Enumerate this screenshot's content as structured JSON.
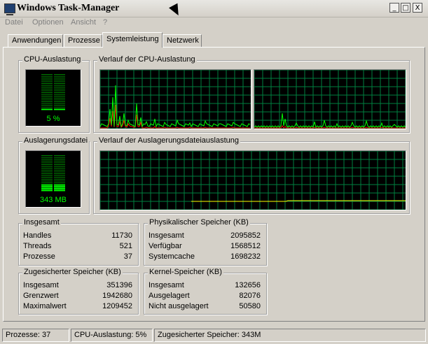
{
  "window": {
    "title": "Windows Task-Manager",
    "buttons": {
      "minimize": "_",
      "maximize": "□",
      "close": "X"
    }
  },
  "menu": {
    "items": [
      "Datei",
      "Optionen",
      "Ansicht",
      "?"
    ]
  },
  "tabs": [
    {
      "label": "Anwendungen",
      "active": false
    },
    {
      "label": "Prozesse",
      "active": false
    },
    {
      "label": "Systemleistung",
      "active": true
    },
    {
      "label": "Netzwerk",
      "active": false
    }
  ],
  "cpu_usage": {
    "title": "CPU-Auslastung",
    "value_text": "5 %",
    "percent": 5
  },
  "cpu_history": {
    "title": "Verlauf der CPU-Auslastung"
  },
  "pagefile": {
    "title": "Auslagerungsdatei",
    "value_text": "343 MB"
  },
  "pagefile_history": {
    "title": "Verlauf der Auslagerungsdateiauslastung"
  },
  "totals": {
    "title": "Insgesamt",
    "rows": [
      {
        "label": "Handles",
        "value": "11730"
      },
      {
        "label": "Threads",
        "value": "521"
      },
      {
        "label": "Prozesse",
        "value": "37"
      }
    ]
  },
  "physical_memory": {
    "title": "Physikalischer Speicher (KB)",
    "rows": [
      {
        "label": "Insgesamt",
        "value": "2095852"
      },
      {
        "label": "Verfügbar",
        "value": "1568512"
      },
      {
        "label": "Systemcache",
        "value": "1698232"
      }
    ]
  },
  "commit_charge": {
    "title": "Zugesicherter Speicher (KB)",
    "rows": [
      {
        "label": "Insgesamt",
        "value": "351396"
      },
      {
        "label": "Grenzwert",
        "value": "1942680"
      },
      {
        "label": "Maximalwert",
        "value": "1209452"
      }
    ]
  },
  "kernel_memory": {
    "title": "Kernel-Speicher (KB)",
    "rows": [
      {
        "label": "Insgesamt",
        "value": "132656"
      },
      {
        "label": "Ausgelagert",
        "value": "82076"
      },
      {
        "label": "Nicht ausgelagert",
        "value": "50580"
      }
    ]
  },
  "statusbar": {
    "processes": "Prozesse: 37",
    "cpu": "CPU-Auslastung: 5%",
    "commit": "Zugesicherter Speicher: 343M"
  },
  "colors": {
    "grid": "#008040",
    "line_green": "#00ff00",
    "line_red": "#ff0000",
    "line_yellow": "#ffff00"
  }
}
